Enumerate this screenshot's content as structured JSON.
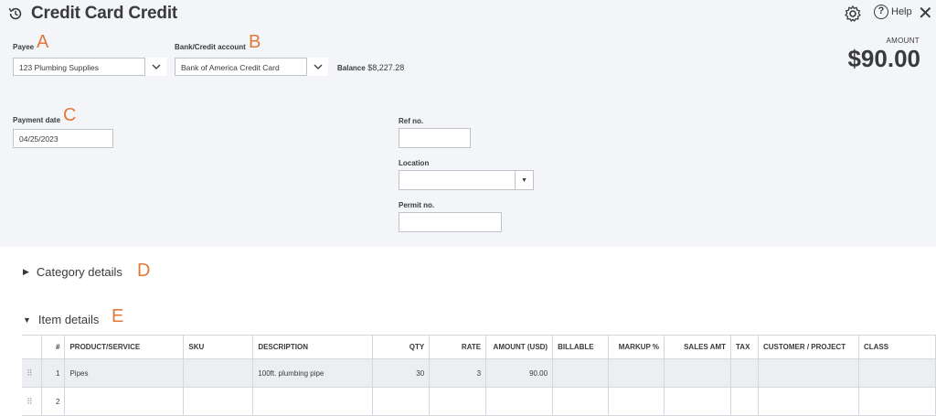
{
  "header": {
    "title": "Credit Card Credit",
    "help_label": "Help",
    "amount_label": "AMOUNT",
    "amount_value": "$90.00"
  },
  "markers": {
    "a": "A",
    "b": "B",
    "c": "C",
    "d": "D",
    "e": "E"
  },
  "form": {
    "payee_label": "Payee",
    "payee_value": "123 Plumbing Supplies",
    "bank_label": "Bank/Credit account",
    "bank_value": "Bank of America Credit Card",
    "balance_label": "Balance",
    "balance_value": "$8,227.28",
    "payment_date_label": "Payment date",
    "payment_date_value": "04/25/2023",
    "ref_label": "Ref no.",
    "ref_value": "",
    "location_label": "Location",
    "location_value": "",
    "permit_label": "Permit no.",
    "permit_value": ""
  },
  "sections": {
    "category": "Category details",
    "items": "Item details"
  },
  "table": {
    "columns": [
      "#",
      "PRODUCT/SERVICE",
      "SKU",
      "DESCRIPTION",
      "QTY",
      "RATE",
      "AMOUNT (USD)",
      "BILLABLE",
      "MARKUP %",
      "SALES AMT",
      "TAX",
      "CUSTOMER / PROJECT",
      "CLASS"
    ],
    "rows": [
      {
        "num": "1",
        "product": "Pipes",
        "sku": "",
        "description": "100ft. plumbing pipe",
        "qty": "30",
        "rate": "3",
        "amount": "90.00",
        "billable": "",
        "markup": "",
        "sales_amt": "",
        "tax": "",
        "customer": "",
        "class": ""
      },
      {
        "num": "2",
        "product": "",
        "sku": "",
        "description": "",
        "qty": "",
        "rate": "",
        "amount": "",
        "billable": "",
        "markup": "",
        "sales_amt": "",
        "tax": "",
        "customer": "",
        "class": ""
      }
    ]
  },
  "colors": {
    "marker": "#e0793a",
    "panel": "#f4f5f8",
    "text": "#393a3d"
  },
  "icons": [
    "history-icon",
    "gear-icon",
    "help-icon",
    "close-icon",
    "chevron-down-icon",
    "drag-handle-icon",
    "triangle-right-icon",
    "triangle-down-icon"
  ]
}
